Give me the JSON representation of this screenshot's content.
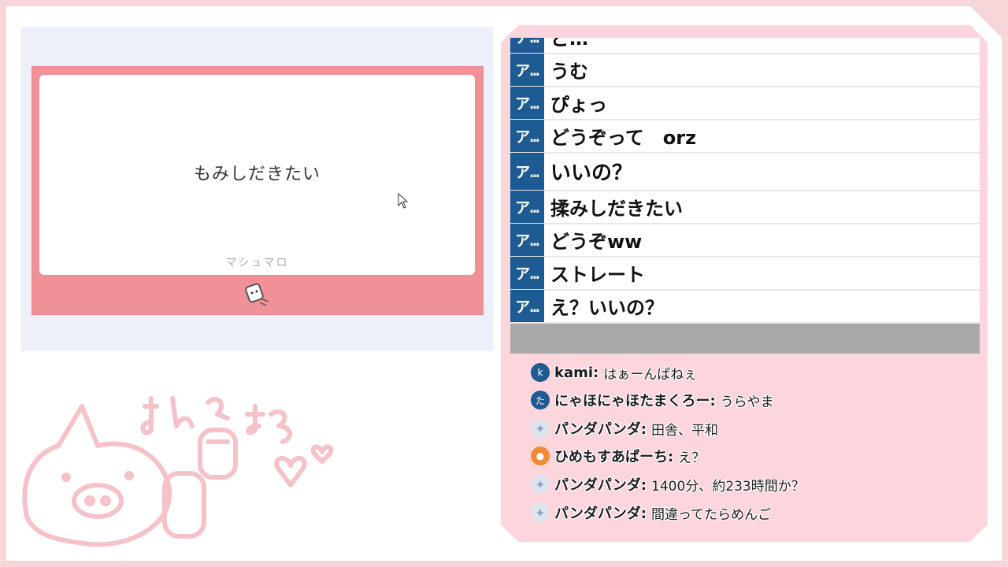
{
  "marshmallow": {
    "question": "もみしだきたい",
    "brand": "マシュマロ"
  },
  "doodle_text": "ましゅまろ",
  "comments": [
    {
      "badge": "ア…",
      "text": "ど…"
    },
    {
      "badge": "ア…",
      "text": "うむ"
    },
    {
      "badge": "ア…",
      "text": "ぴょっ"
    },
    {
      "badge": "ア…",
      "text": "どうぞって　orz"
    },
    {
      "badge": "ア…",
      "text": "いいの？"
    },
    {
      "badge": "ア…",
      "text": "揉みしだきたい"
    },
    {
      "badge": "ア…",
      "text": "どうぞww"
    },
    {
      "badge": "ア…",
      "text": "ストレート"
    },
    {
      "badge": "ア…",
      "text": "え？いいの？"
    }
  ],
  "chat": [
    {
      "avatar": "k",
      "avatar_style": "blue",
      "name": "kami:",
      "message": "はぁーんぱねぇ"
    },
    {
      "avatar": "た",
      "avatar_style": "blue",
      "name": "にゃほにゃほたまくろー:",
      "message": "うらやま"
    },
    {
      "avatar": "✦",
      "avatar_style": "crystal",
      "name": "パンダパンダ:",
      "message": "田舎、平和"
    },
    {
      "avatar": "●",
      "avatar_style": "orange",
      "name": "ひめもすあぱーち:",
      "message": "え？"
    },
    {
      "avatar": "✦",
      "avatar_style": "crystal",
      "name": "パンダパンダ:",
      "message": "1400分、約233時間か？"
    },
    {
      "avatar": "✦",
      "avatar_style": "crystal",
      "name": "パンダパンダ:",
      "message": "間違ってたらめんご"
    }
  ],
  "colors": {
    "accent_pink": "#ef9196",
    "panel_pink": "#fcd6dc",
    "badge_blue": "#1f5b93"
  }
}
